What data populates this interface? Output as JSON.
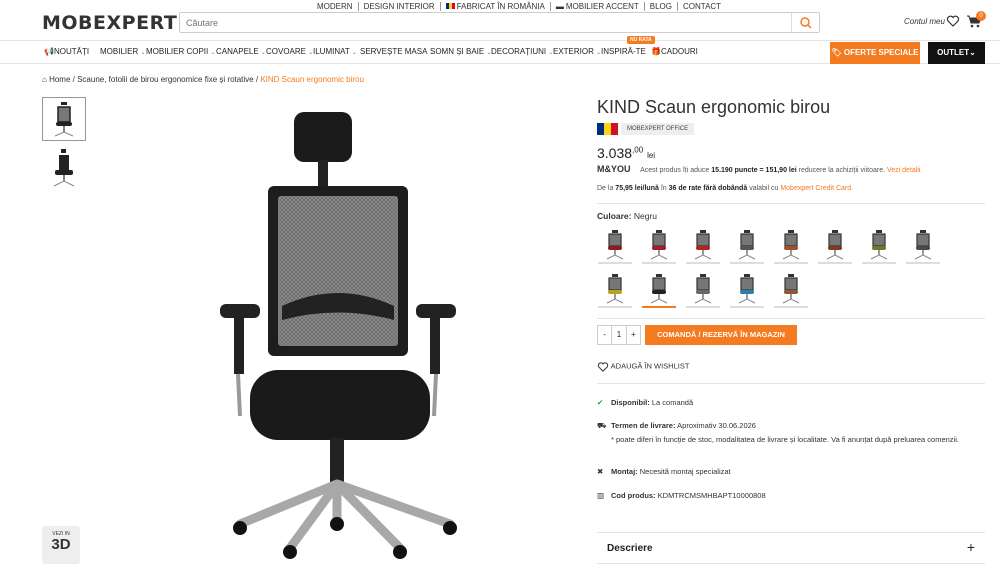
{
  "header": {
    "logo": "MOBEXPERT",
    "top_links": [
      "MODERN",
      "DESIGN INTERIOR",
      "FABRICAT ÎN ROMÂNIA",
      "MOBILIER ACCENT",
      "BLOG",
      "CONTACT"
    ],
    "search_placeholder": "Căutare",
    "account_label": "Contul meu",
    "cart_count": "0"
  },
  "nav": {
    "items": [
      "NOUTĂȚI",
      "MOBILIER",
      "MOBILIER COPII",
      "CANAPELE",
      "COVOARE",
      "ILUMINAT",
      "SERVEȘTE MASA",
      "SOMN ȘI BAIE",
      "DECORAȚIUNI",
      "EXTERIOR",
      "INSPIRĂ-TE",
      "CADOURI"
    ],
    "new_badge": "NU RATA",
    "offers_label": "OFERTE SPECIALE",
    "outlet_label": "OUTLET"
  },
  "breadcrumb": {
    "home": "Home",
    "category": "Scaune, fotolii de birou ergonomice fixe și rotative",
    "current": "KIND Scaun ergonomic birou"
  },
  "gallery": {
    "view3d_small": "VEZI IN",
    "view3d_big": "3D"
  },
  "product": {
    "title": "KIND Scaun ergonomic birou",
    "brand": "MOBEXPERT OFFICE",
    "price_main": "3.038",
    "price_dec": ",00",
    "price_cur": "lei",
    "myou_logo": "M&YOU",
    "myou_text_a": "Acest produs îți aduce",
    "myou_points": "15.190 puncte = 151,90 lei",
    "myou_text_b": "reducere la achiziții viitoare.",
    "myou_link": "Vezi detalii.",
    "rate_a": "De la",
    "rate_amount": "75,95 lei/lună",
    "rate_b": "în",
    "rate_months": "36 de rate fără dobândă",
    "rate_c": "valabil cu",
    "rate_link": "Mobexpert Credit Card.",
    "color_label": "Culoare",
    "color_value": "Negru",
    "qty_minus": "-",
    "qty_value": "1",
    "qty_plus": "+",
    "order_label": "COMANDĂ / REZERVĂ ÎN MAGAZIN",
    "wishlist_label": "ADAUGĂ ÎN WISHLIST",
    "availability_label": "Disponibil:",
    "availability_value": "La comandă",
    "delivery_label": "Termen de livrare:",
    "delivery_value": "Aproximativ 30.06.2026",
    "delivery_note": "* poate diferi în funcție de stoc, modalitatea de livrare și localitate. Va fi anunțat după preluarea comenzii.",
    "assembly_label": "Montaj:",
    "assembly_value": "Necesită montaj specializat",
    "code_label": "Cod produs:",
    "code_value": "KDMTRCMSMHBAPT10000808",
    "description_label": "Descriere",
    "description_toggle": "+"
  },
  "swatch_seat_colors": [
    "#8b1c1c",
    "#a01c2e",
    "#b3261e",
    "#555555",
    "#a0522d",
    "#7a3b1e",
    "#6b7a2a",
    "#4a4a4a",
    "#b8a21c",
    "#222222",
    "#6a6a6a",
    "#2e7fa8",
    "#8b5a3c"
  ],
  "colors": {
    "accent": "#f47b20",
    "dark": "#111111"
  }
}
